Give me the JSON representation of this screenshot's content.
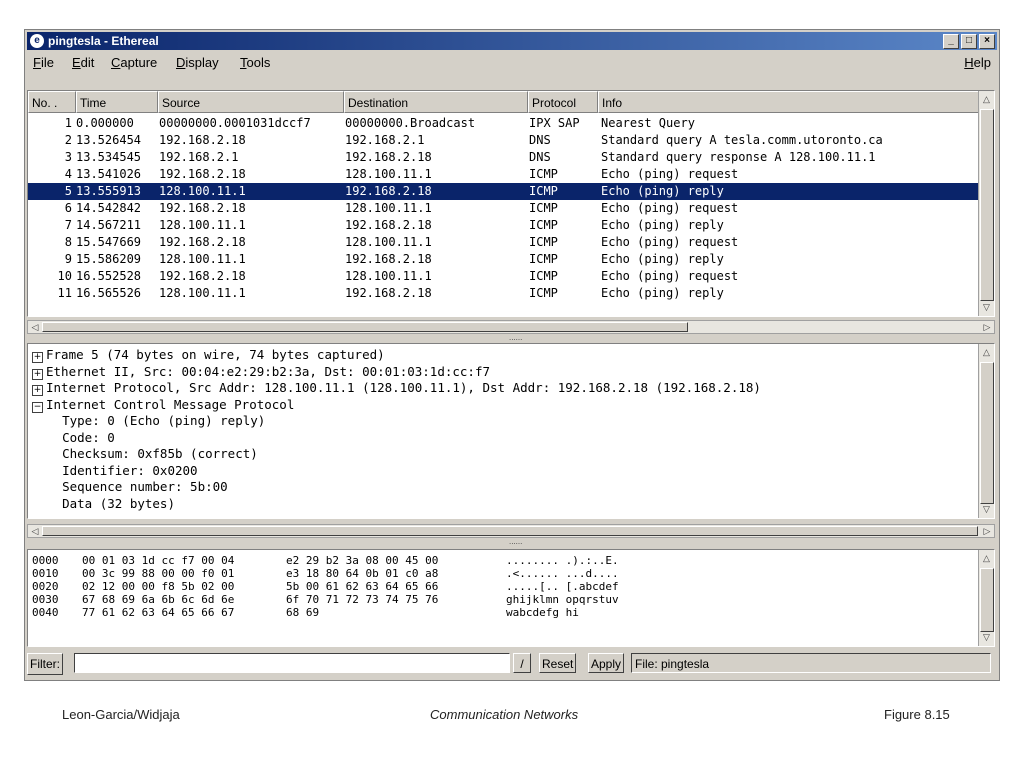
{
  "window": {
    "title": "pingtesla - Ethereal",
    "controls": [
      "_",
      "□",
      "×"
    ]
  },
  "menu": {
    "items": [
      "File",
      "Edit",
      "Capture",
      "Display",
      "Tools"
    ],
    "help": "Help"
  },
  "packet_list": {
    "columns": [
      "No. .",
      "Time",
      "Source",
      "Destination",
      "Protocol",
      "Info"
    ],
    "rows": [
      {
        "no": "1",
        "time": "0.000000",
        "src": "00000000.0001031dccf7",
        "dst": "00000000.Broadcast",
        "proto": "IPX SAP",
        "info": "Nearest Query"
      },
      {
        "no": "2",
        "time": "13.526454",
        "src": "192.168.2.18",
        "dst": "192.168.2.1",
        "proto": "DNS",
        "info": "Standard query A tesla.comm.utoronto.ca"
      },
      {
        "no": "3",
        "time": "13.534545",
        "src": "192.168.2.1",
        "dst": "192.168.2.18",
        "proto": "DNS",
        "info": "Standard query response A 128.100.11.1"
      },
      {
        "no": "4",
        "time": "13.541026",
        "src": "192.168.2.18",
        "dst": "128.100.11.1",
        "proto": "ICMP",
        "info": "Echo (ping) request"
      },
      {
        "no": "5",
        "time": "13.555913",
        "src": "128.100.11.1",
        "dst": "192.168.2.18",
        "proto": "ICMP",
        "info": "Echo (ping) reply"
      },
      {
        "no": "6",
        "time": "14.542842",
        "src": "192.168.2.18",
        "dst": "128.100.11.1",
        "proto": "ICMP",
        "info": "Echo (ping) request"
      },
      {
        "no": "7",
        "time": "14.567211",
        "src": "128.100.11.1",
        "dst": "192.168.2.18",
        "proto": "ICMP",
        "info": "Echo (ping) reply"
      },
      {
        "no": "8",
        "time": "15.547669",
        "src": "192.168.2.18",
        "dst": "128.100.11.1",
        "proto": "ICMP",
        "info": "Echo (ping) request"
      },
      {
        "no": "9",
        "time": "15.586209",
        "src": "128.100.11.1",
        "dst": "192.168.2.18",
        "proto": "ICMP",
        "info": "Echo (ping) reply"
      },
      {
        "no": "10",
        "time": "16.552528",
        "src": "192.168.2.18",
        "dst": "128.100.11.1",
        "proto": "ICMP",
        "info": "Echo (ping) request"
      },
      {
        "no": "11",
        "time": "16.565526",
        "src": "128.100.11.1",
        "dst": "192.168.2.18",
        "proto": "ICMP",
        "info": "Echo (ping) reply"
      }
    ],
    "selected_row": 5,
    "selection_color": "#0a246a"
  },
  "detail_tree": [
    {
      "expander": "⊞",
      "text": "Frame 5 (74 bytes on wire, 74 bytes captured)"
    },
    {
      "expander": "⊞",
      "text": "Ethernet II, Src: 00:04:e2:29:b2:3a, Dst: 00:01:03:1d:cc:f7"
    },
    {
      "expander": "⊞",
      "text": "Internet Protocol, Src Addr: 128.100.11.1 (128.100.11.1), Dst Addr: 192.168.2.18 (192.168.2.18)"
    },
    {
      "expander": "⊟",
      "text": "Internet Control Message Protocol"
    },
    {
      "expander": "",
      "text": "    Type: 0 (Echo (ping) reply)"
    },
    {
      "expander": "",
      "text": "    Code: 0"
    },
    {
      "expander": "",
      "text": "    Checksum: 0xf85b (correct)"
    },
    {
      "expander": "",
      "text": "    Identifier: 0x0200"
    },
    {
      "expander": "",
      "text": "    Sequence number: 5b:00"
    },
    {
      "expander": "",
      "text": "    Data (32 bytes)"
    }
  ],
  "hex_dump": [
    {
      "offset": "0000",
      "hex1": "00 01 03 1d cc f7 00 04",
      "hex2": "e2 29 b2 3a 08 00 45 00",
      "ascii": "........ .).:..E."
    },
    {
      "offset": "0010",
      "hex1": "00 3c 99 88 00 00 f0 01",
      "hex2": "e3 18 80 64 0b 01 c0 a8",
      "ascii": ".<...... ...d...."
    },
    {
      "offset": "0020",
      "hex1": "02 12 00 00 f8 5b 02 00",
      "hex2": "5b 00 61 62 63 64 65 66",
      "ascii": ".....[.. [.abcdef"
    },
    {
      "offset": "0030",
      "hex1": "67 68 69 6a 6b 6c 6d 6e",
      "hex2": "6f 70 71 72 73 74 75 76",
      "ascii": "ghijklmn opqrstuv"
    },
    {
      "offset": "0040",
      "hex1": "77 61 62 63 64 65 66 67",
      "hex2": "68 69",
      "ascii": "wabcdefg hi"
    }
  ],
  "filter_bar": {
    "label": "Filter:",
    "value": "",
    "reset": "Reset",
    "apply": "Apply",
    "file": "File: pingtesla"
  },
  "footer": {
    "left": "Leon-Garcia/Widjaja",
    "center": "Communication Networks",
    "right": "Figure 8.15"
  }
}
